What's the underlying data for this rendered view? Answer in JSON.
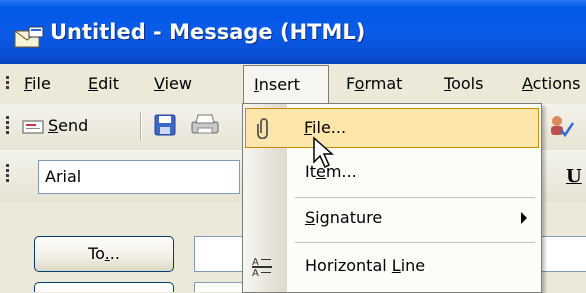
{
  "window": {
    "title": "Untitled - Message (HTML)",
    "icon": "envelope-icon"
  },
  "menubar": {
    "items": [
      {
        "label": "File",
        "accel_index": 0
      },
      {
        "label": "Edit",
        "accel_index": 0
      },
      {
        "label": "View",
        "accel_index": 0
      },
      {
        "label": "Insert",
        "accel_index": 0
      },
      {
        "label": "Format",
        "accel_index": 1
      },
      {
        "label": "Tools",
        "accel_index": 0
      },
      {
        "label": "Actions",
        "accel_index": 0
      }
    ],
    "open_menu": "Insert"
  },
  "toolbar": {
    "send_label": "Send",
    "font_name": "Arial",
    "underline_label": "U"
  },
  "form": {
    "to_button_label": "To..."
  },
  "insert_menu": {
    "items": [
      {
        "label": "File...",
        "icon": "paperclip-icon",
        "highlighted": true
      },
      {
        "label": "Item...",
        "icon": "",
        "highlighted": false
      },
      {
        "label": "Signature",
        "icon": "",
        "submenu": true
      },
      {
        "label": "Horizontal Line",
        "icon": "horizontal-line-icon"
      }
    ]
  },
  "colors": {
    "titlebar": "#0a5ce8",
    "highlight_bg": "#fde6a9",
    "highlight_border": "#d18a00"
  }
}
